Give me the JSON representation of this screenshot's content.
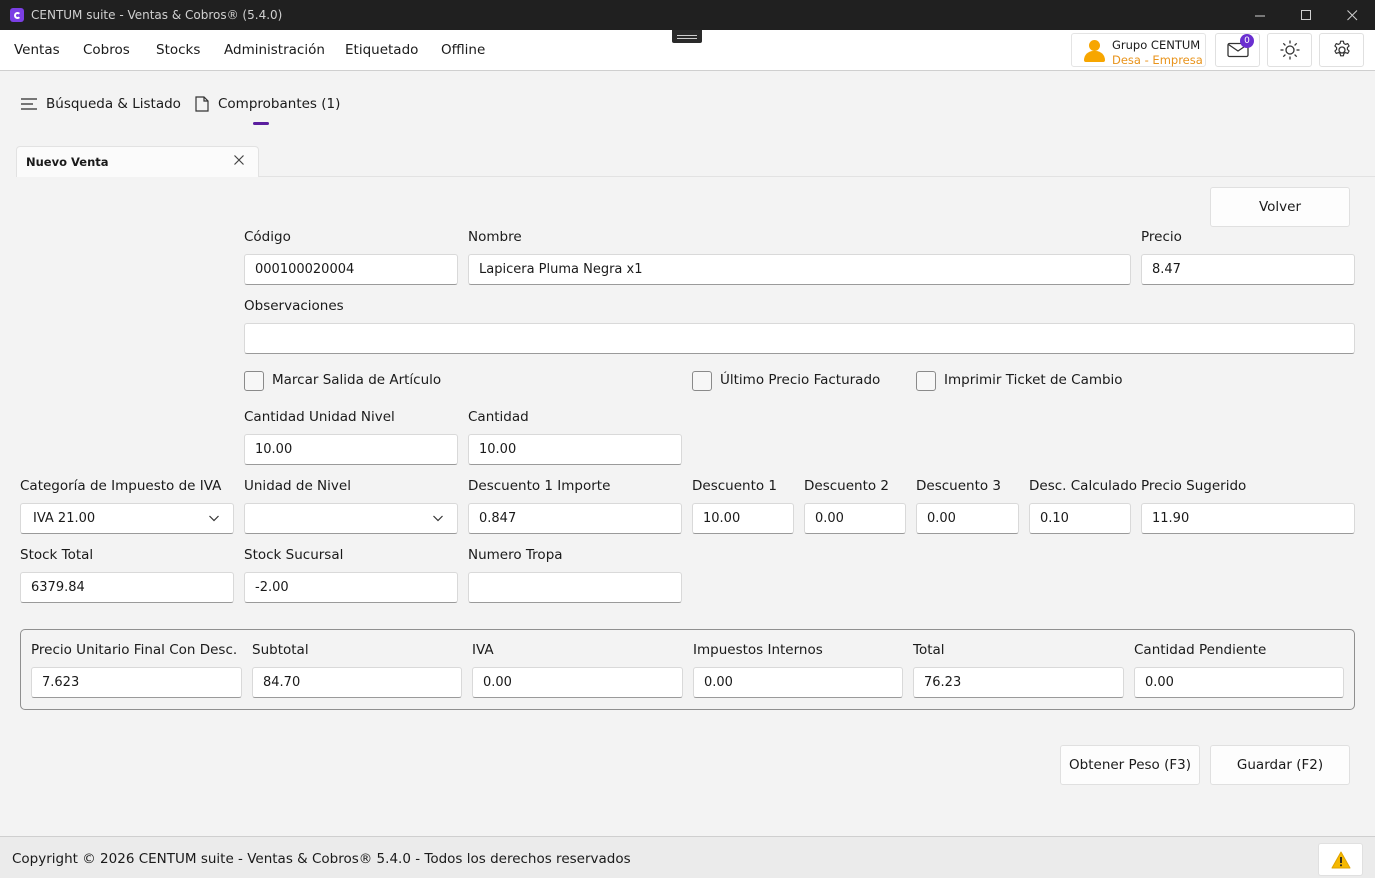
{
  "window": {
    "title": "CENTUM suite - Ventas & Cobros® (5.4.0)",
    "controls": [
      "minimize",
      "maximize",
      "close"
    ]
  },
  "menu": {
    "items": [
      "Ventas",
      "Cobros",
      "Stocks",
      "Administración",
      "Etiquetado",
      "Offline"
    ]
  },
  "user": {
    "group": "Grupo CENTUM",
    "company": "Desa - Empresa",
    "mail_badge": "0"
  },
  "nav_tabs": {
    "search": "Búsqueda & Listado",
    "vouchers": "Comprobantes (1)"
  },
  "doc_tab": {
    "label": "Nuevo Venta"
  },
  "actions": {
    "back": "Volver",
    "get_weight": "Obtener Peso (F3)",
    "save": "Guardar (F2)"
  },
  "form": {
    "codigo": {
      "label": "Código",
      "value": "000100020004"
    },
    "nombre": {
      "label": "Nombre",
      "value": "Lapicera Pluma Negra x1"
    },
    "precio": {
      "label": "Precio",
      "value": "8.47"
    },
    "observaciones": {
      "label": "Observaciones",
      "value": ""
    },
    "marcar_salida": {
      "label": "Marcar Salida de Artículo",
      "checked": false
    },
    "ultimo_precio": {
      "label": "Último Precio Facturado",
      "checked": false
    },
    "imprimir_ticket": {
      "label": "Imprimir Ticket de Cambio",
      "checked": false
    },
    "cantidad_unidad_nivel": {
      "label": "Cantidad Unidad Nivel",
      "value": "10.00"
    },
    "cantidad": {
      "label": "Cantidad",
      "value": "10.00"
    },
    "categoria_iva": {
      "label": "Categoría de Impuesto de IVA",
      "value": "IVA 21.00"
    },
    "unidad_nivel": {
      "label": "Unidad de Nivel",
      "value": ""
    },
    "descuento1_importe": {
      "label": "Descuento 1 Importe",
      "value": "0.847"
    },
    "descuento1": {
      "label": "Descuento 1",
      "value": "10.00"
    },
    "descuento2": {
      "label": "Descuento 2",
      "value": "0.00"
    },
    "descuento3": {
      "label": "Descuento 3",
      "value": "0.00"
    },
    "desc_calculado": {
      "label": "Desc. Calculado",
      "value": "0.10"
    },
    "precio_sugerido": {
      "label": "Precio Sugerido",
      "value": "11.90"
    },
    "stock_total": {
      "label": "Stock Total",
      "value": "6379.84"
    },
    "stock_sucursal": {
      "label": "Stock Sucursal",
      "value": "-2.00"
    },
    "numero_tropa": {
      "label": "Numero Tropa",
      "value": ""
    }
  },
  "totals": {
    "precio_unitario_final": {
      "label": "Precio Unitario Final Con Desc.",
      "value": "7.623"
    },
    "subtotal": {
      "label": "Subtotal",
      "value": "84.70"
    },
    "iva": {
      "label": "IVA",
      "value": "0.00"
    },
    "impuestos_internos": {
      "label": "Impuestos Internos",
      "value": "0.00"
    },
    "total": {
      "label": "Total",
      "value": "76.23"
    },
    "cantidad_pendiente": {
      "label": "Cantidad Pendiente",
      "value": "0.00"
    }
  },
  "footer": {
    "copyright": "Copyright © 2026 CENTUM suite - Ventas & Cobros® 5.4.0 - Todos los derechos reservados"
  },
  "colors": {
    "accent": "#5a1d9e",
    "brand": "#7b3fe4",
    "user_company": "#e8931b",
    "warning": "#f5b800"
  }
}
